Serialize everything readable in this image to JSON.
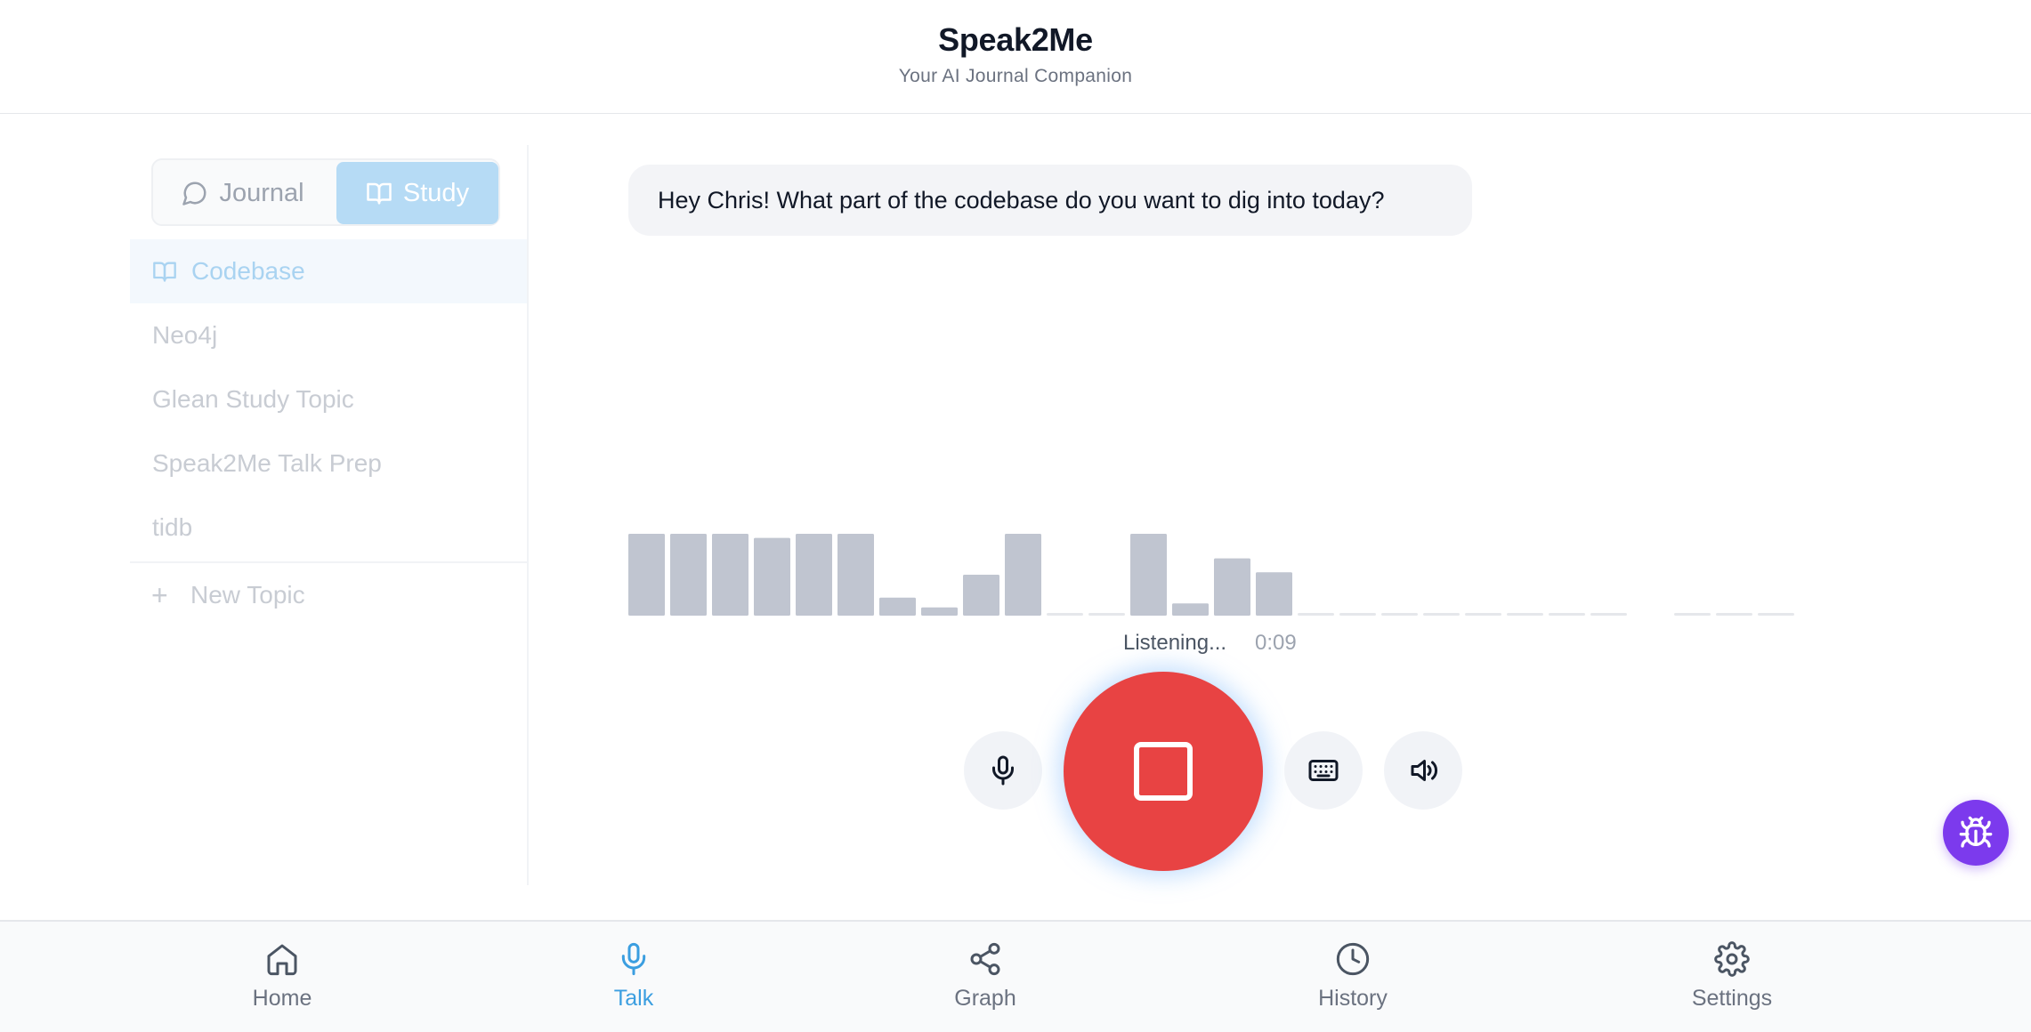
{
  "header": {
    "title": "Speak2Me",
    "subtitle": "Your AI Journal Companion"
  },
  "sidebar": {
    "modes": [
      {
        "label": "Journal",
        "icon": "chat-bubble-icon",
        "active": false
      },
      {
        "label": "Study",
        "icon": "book-open-icon",
        "active": true
      }
    ],
    "topics": [
      {
        "label": "Codebase",
        "active": true
      },
      {
        "label": "Neo4j",
        "active": false
      },
      {
        "label": "Glean Study Topic",
        "active": false
      },
      {
        "label": "Speak2Me Talk Prep",
        "active": false
      },
      {
        "label": "tidb",
        "active": false
      }
    ],
    "new_topic_label": "New Topic"
  },
  "chat": {
    "message": "Hey Chris! What part of the codebase do you want to dig into today?"
  },
  "recorder": {
    "status": "Listening...",
    "timer": "0:09",
    "levels": [
      1,
      1,
      1,
      0.95,
      1,
      1,
      0.22,
      0.1,
      0.5,
      1,
      0.03,
      0.03,
      1,
      0.15,
      0.7,
      0.53,
      0.03,
      0.03,
      0.03,
      0.03,
      0.03,
      0.03,
      0.03,
      0.03,
      0,
      0.03,
      0.03,
      0.03
    ]
  },
  "controls": {
    "mic": "mic-icon",
    "stop": "stop-icon",
    "keyboard": "keyboard-icon",
    "speaker": "speaker-icon",
    "debug": "bug-icon"
  },
  "nav": [
    {
      "label": "Home",
      "icon": "home-icon",
      "active": false
    },
    {
      "label": "Talk",
      "icon": "mic-icon",
      "active": true
    },
    {
      "label": "Graph",
      "icon": "share-graph-icon",
      "active": false
    },
    {
      "label": "History",
      "icon": "clock-icon",
      "active": false
    },
    {
      "label": "Settings",
      "icon": "gear-icon",
      "active": false
    }
  ],
  "colors": {
    "accent": "#3b9ee0",
    "stop": "#e84343",
    "bug": "#7c3aed",
    "bar": "#c0c5d0"
  }
}
